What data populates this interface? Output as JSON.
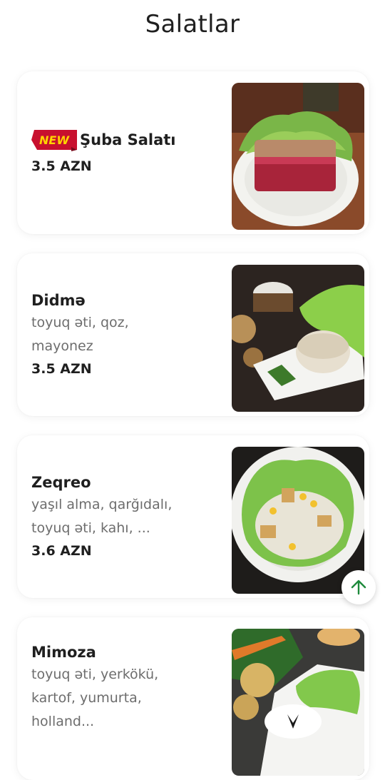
{
  "page": {
    "title": "Salatlar"
  },
  "badge": {
    "new_text": "NEW",
    "color_fill": "#c8102e",
    "color_text": "#ffd400"
  },
  "items": [
    {
      "name": "Şuba Salatı",
      "description": [],
      "price": "3.5 AZN",
      "is_new": true
    },
    {
      "name": "Didmə",
      "description": [
        "toyuq əti, qoz,",
        "mayonez"
      ],
      "price": "3.5 AZN",
      "is_new": false
    },
    {
      "name": "Zeqreo",
      "description": [
        "yaşıl alma, qarğıdalı,",
        "toyuq əti, kahı, ..."
      ],
      "price": "3.6 AZN",
      "is_new": false
    },
    {
      "name": "Mimoza",
      "description": [
        "toyuq əti, yerkökü,",
        "kartof, yumurta,",
        "holland..."
      ],
      "price": "",
      "is_new": false
    }
  ],
  "scroll_top": {
    "icon": "arrow-up-icon",
    "color": "#1e8a3c"
  }
}
